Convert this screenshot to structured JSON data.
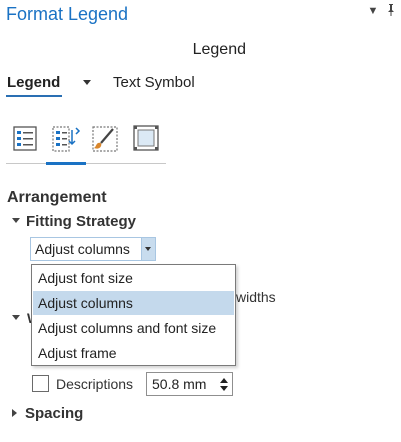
{
  "pane": {
    "title": "Format Legend",
    "menu_icon": "chevron-down-icon",
    "pin_icon": "pin-icon",
    "menu_glyph": "▼",
    "pin_glyph": "📌"
  },
  "element_name": "Legend",
  "tabs": {
    "legend_label": "Legend",
    "text_symbol_label": "Text Symbol"
  },
  "icon_tabs": [
    {
      "name": "options-icon",
      "active": false
    },
    {
      "name": "arrangement-icon",
      "active": true
    },
    {
      "name": "symbol-brush-icon",
      "active": false
    },
    {
      "name": "display-frame-icon",
      "active": false
    }
  ],
  "arrangement": {
    "title": "Arrangement",
    "fitting_strategy": {
      "header": "Fitting Strategy",
      "selected_value": "Adjust columns",
      "options": [
        "Adjust font size",
        "Adjust columns",
        "Adjust columns and font size",
        "Adjust frame"
      ],
      "selected_index": 1
    },
    "partial_behind_text": "widths",
    "partial_group_initial": "W",
    "descriptions": {
      "label": "Descriptions",
      "checked": false,
      "value": "50.8 mm"
    },
    "spacing_header": "Spacing"
  },
  "colors": {
    "accent": "#1a72c4",
    "selection": "#c4d9ec"
  }
}
